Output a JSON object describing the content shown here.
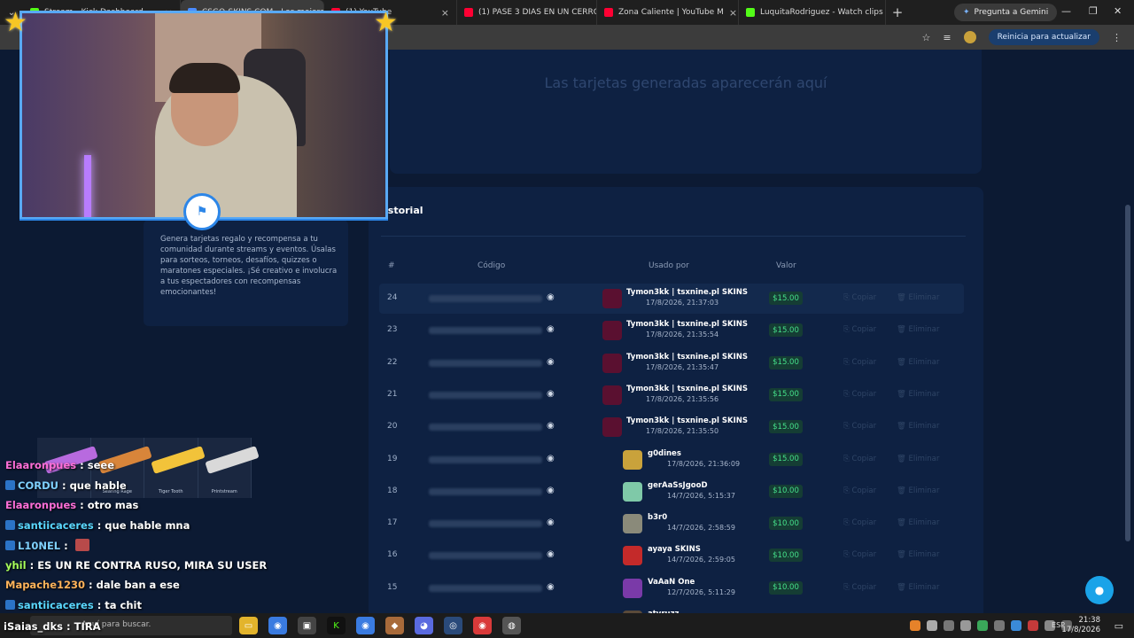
{
  "browser": {
    "tabs": [
      {
        "title": "Stream - Kick Dashboard",
        "icon": "kick-icon",
        "color": "#53fc18"
      },
      {
        "title": "CSGO-SKINS.COM - Los mejores",
        "icon": "site-icon",
        "color": "#4a8cff"
      },
      {
        "title": "(1) YouTube",
        "icon": "youtube-icon",
        "color": "#ff0033"
      },
      {
        "title": "(1) PASE 3 DIAS EN UN CERRO ,",
        "icon": "youtube-icon",
        "color": "#ff0033"
      },
      {
        "title": "Zona Caliente | YouTube M",
        "icon": "youtube-music-icon",
        "color": "#ff0033"
      },
      {
        "title": "LuquitaRodriguez - Watch clips",
        "icon": "kick-icon",
        "color": "#53fc18"
      }
    ],
    "gemini_label": "Pregunta a Gemini",
    "update_label": "Reinicia para actualizar"
  },
  "page": {
    "empty_cards_text": "Las tarjetas generadas aparecerán aquí",
    "history_title": "Historial",
    "history_title_visible": "istorial",
    "description": "Genera tarjetas regalo y recompensa a tu comunidad durante streams y eventos. Úsalas para sorteos, torneos, desafíos, quizzes o maratones especiales. ¡Sé creativo e involucra a tus espectadores con recompensas emocionantes!",
    "columns": {
      "num": "#",
      "code": "Código",
      "used_by": "Usado por",
      "value": "Valor"
    },
    "copy_label": "Copiar",
    "delete_label": "Eliminar",
    "rows": [
      {
        "num": "24",
        "user": "Tymon3kk | tsxnine.pl SKINS",
        "date": "17/8/2026, 21:37:03",
        "value": "$15.00",
        "avatar": "#5a1030"
      },
      {
        "num": "23",
        "user": "Tymon3kk | tsxnine.pl SKINS",
        "date": "17/8/2026, 21:35:54",
        "value": "$15.00",
        "avatar": "#5a1030"
      },
      {
        "num": "22",
        "user": "Tymon3kk | tsxnine.pl SKINS",
        "date": "17/8/2026, 21:35:47",
        "value": "$15.00",
        "avatar": "#5a1030"
      },
      {
        "num": "21",
        "user": "Tymon3kk | tsxnine.pl SKINS",
        "date": "17/8/2026, 21:35:56",
        "value": "$15.00",
        "avatar": "#5a1030"
      },
      {
        "num": "20",
        "user": "Tymon3kk | tsxnine.pl SKINS",
        "date": "17/8/2026, 21:35:50",
        "value": "$15.00",
        "avatar": "#5a1030"
      },
      {
        "num": "19",
        "user": "g0dines",
        "date": "17/8/2026, 21:36:09",
        "value": "$15.00",
        "avatar": "#c9a23b"
      },
      {
        "num": "18",
        "user": "gerAaSsJgooD",
        "date": "14/7/2026, 5:15:37",
        "value": "$10.00",
        "avatar": "#7fc9a8"
      },
      {
        "num": "17",
        "user": "b3r0",
        "date": "14/7/2026, 2:58:59",
        "value": "$10.00",
        "avatar": "#8a8a7a"
      },
      {
        "num": "16",
        "user": "ayaya SKINS",
        "date": "14/7/2026, 2:59:05",
        "value": "$10.00",
        "avatar": "#c42a2a"
      },
      {
        "num": "15",
        "user": "VaAaN One",
        "date": "12/7/2026, 5:11:29",
        "value": "$10.00",
        "avatar": "#7a3aa8"
      },
      {
        "num": "14",
        "user": "atyruzz",
        "date": "",
        "value": "",
        "avatar": "#5a4a3a"
      }
    ]
  },
  "chat": [
    {
      "user": "Elaaronpues",
      "msg": "seee",
      "color": "#ff6fd8",
      "badge": false
    },
    {
      "user": "CORDU",
      "msg": "que hable",
      "color": "#7fd1ff",
      "badge": true
    },
    {
      "user": "Elaaronpues",
      "msg": "otro mas",
      "color": "#ff6fd8",
      "badge": false
    },
    {
      "user": "santiicaceres",
      "msg": "que hable mna",
      "color": "#5ad8ff",
      "badge": true
    },
    {
      "user": "L10NEL",
      "msg": "",
      "color": "#7fd1ff",
      "badge": true
    },
    {
      "user": "yhil",
      "msg": "ES UN RE CONTRA RUSO, MIRA SU USER",
      "color": "#a8ff5a",
      "badge": false
    },
    {
      "user": "Mapache1230",
      "msg": "dale ban a ese",
      "color": "#ffb35a",
      "badge": false
    },
    {
      "user": "santiicaceres",
      "msg": "ta chit",
      "color": "#5ad8ff",
      "badge": true
    }
  ],
  "overlay_name": "iSaias_dks",
  "overlay_msg": "TIRA",
  "skins": [
    {
      "label": "",
      "color": "#b86adf"
    },
    {
      "label": "Searing Rage",
      "color": "#d8853a"
    },
    {
      "label": "Tiger Tooth",
      "color": "#f2c33a"
    },
    {
      "label": "Printstream",
      "color": "#d9d9d9"
    }
  ],
  "taskbar": {
    "search_placeholder": "Aquí para buscar.",
    "lang": "ESP",
    "time": "21:38",
    "date": "17/8/2026"
  }
}
